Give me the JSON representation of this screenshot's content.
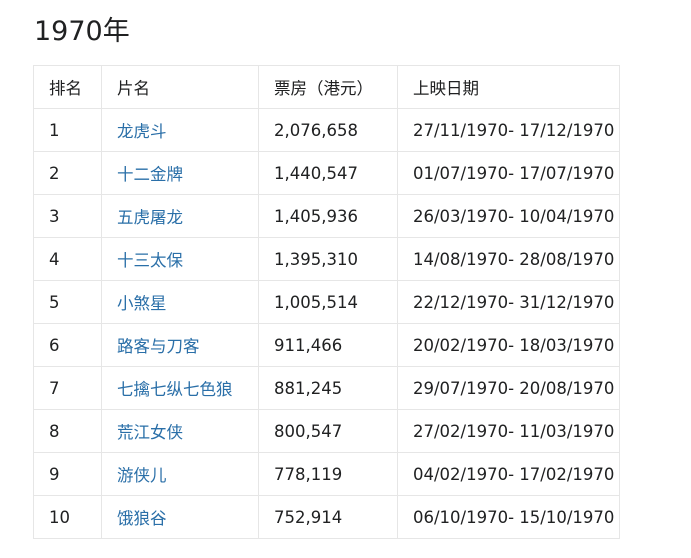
{
  "page": {
    "title": "1970年"
  },
  "table": {
    "headers": {
      "rank": "排名",
      "title": "片名",
      "gross": "票房（港元）",
      "dates": "上映日期"
    },
    "rows": [
      {
        "rank": "1",
        "title": "龙虎斗",
        "gross": "2,076,658",
        "dates": "27/11/1970- 17/12/1970"
      },
      {
        "rank": "2",
        "title": "十二金牌",
        "gross": "1,440,547",
        "dates": "01/07/1970- 17/07/1970"
      },
      {
        "rank": "3",
        "title": "五虎屠龙",
        "gross": "1,405,936",
        "dates": "26/03/1970- 10/04/1970"
      },
      {
        "rank": "4",
        "title": "十三太保",
        "gross": "1,395,310",
        "dates": "14/08/1970- 28/08/1970"
      },
      {
        "rank": "5",
        "title": "小煞星",
        "gross": "1,005,514",
        "dates": "22/12/1970- 31/12/1970"
      },
      {
        "rank": "6",
        "title": "路客与刀客",
        "gross": "911,466",
        "dates": "20/02/1970- 18/03/1970"
      },
      {
        "rank": "7",
        "title": "七擒七纵七色狼",
        "gross": "881,245",
        "dates": "29/07/1970- 20/08/1970"
      },
      {
        "rank": "8",
        "title": "荒江女侠",
        "gross": "800,547",
        "dates": "27/02/1970- 11/03/1970"
      },
      {
        "rank": "9",
        "title": "游侠儿",
        "gross": "778,119",
        "dates": "04/02/1970- 17/02/1970"
      },
      {
        "rank": "10",
        "title": "饿狼谷",
        "gross": "752,914",
        "dates": "06/10/1970- 15/10/1970"
      }
    ]
  },
  "colors": {
    "link": "#2a6fa8",
    "border": "#e6e6e6",
    "text": "#202122"
  }
}
